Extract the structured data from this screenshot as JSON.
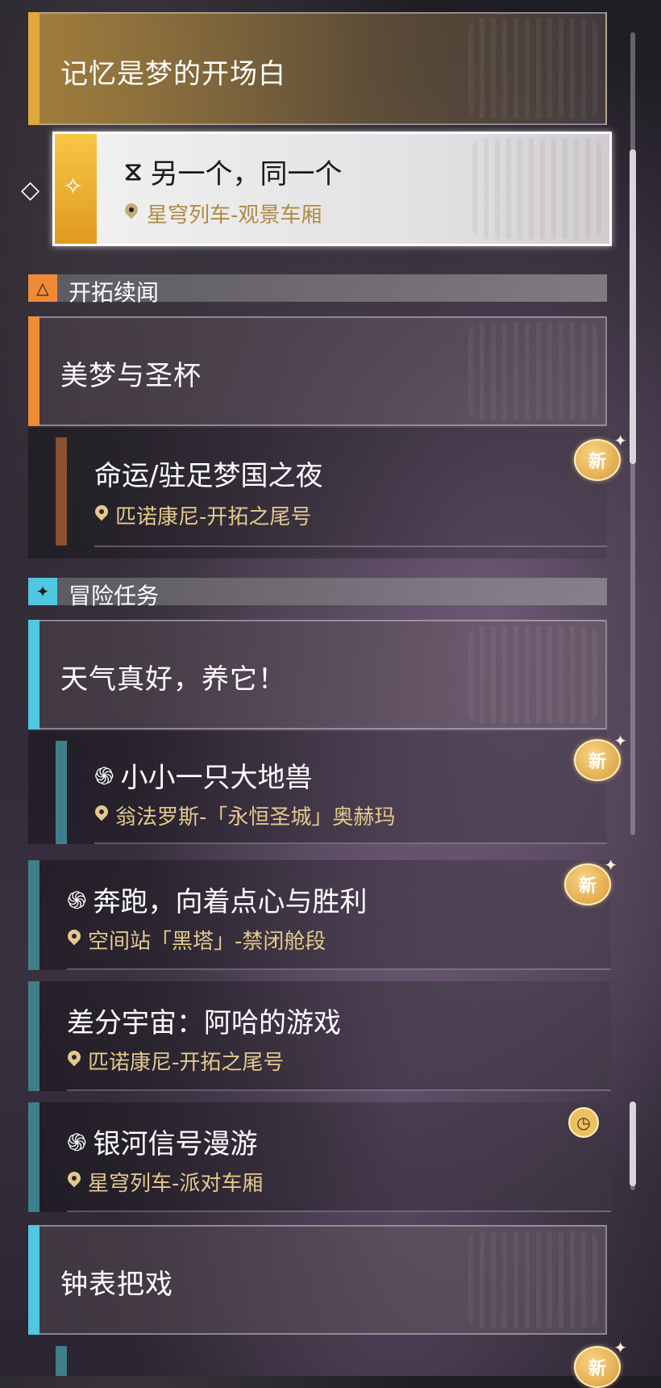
{
  "top_card": {
    "title": "记忆是梦的开场白",
    "accent": "#d6a23a"
  },
  "selected_mission": {
    "icon": "hourglass-icon",
    "title": "另一个，同一个",
    "location": "星穹列车-观景车厢"
  },
  "sections": [
    {
      "label": "开拓续闻",
      "icon": "trailblaze-icon",
      "color": "#f08a35"
    },
    {
      "label": "冒险任务",
      "icon": "sparkle-icon",
      "color": "#4fc7e0"
    }
  ],
  "trailblaze": {
    "card": {
      "title": "美梦与圣杯"
    },
    "items": [
      {
        "title": "命运/驻足梦国之夜",
        "location": "匹诺康尼-开拓之尾号",
        "badge": "新"
      }
    ]
  },
  "adventure": {
    "card": {
      "title": "天气真好，养它！"
    },
    "items": [
      {
        "title": "小小一只大地兽",
        "location": "翁法罗斯-「永恒圣城」奥赫玛",
        "badge": "新",
        "icon": "swirl-icon"
      },
      {
        "title": "奔跑，向着点心与胜利",
        "location": "空间站「黑塔」-禁闭舱段",
        "badge": "新",
        "icon": "swirl-icon"
      },
      {
        "title": "差分宇宙：阿哈的游戏",
        "location": "匹诺康尼-开拓之尾号"
      },
      {
        "title": "银河信号漫游",
        "location": "星穹列车-派对车厢",
        "icon": "swirl-icon",
        "status_icon": "clock-icon"
      }
    ],
    "card2": {
      "title": "钟表把戏"
    },
    "bottom_badge": "新"
  }
}
